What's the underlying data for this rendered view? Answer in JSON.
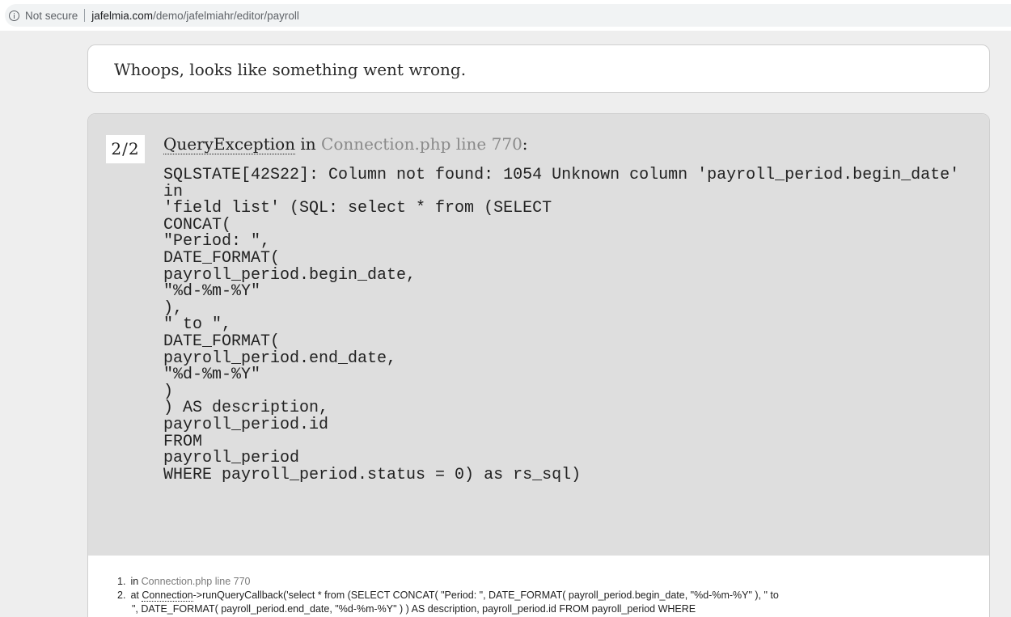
{
  "browser": {
    "security_icon": "info-icon",
    "security_label": "Not secure",
    "url_domain": "jafelmia.com",
    "url_path": "/demo/jafelmiahr/editor/payroll"
  },
  "page": {
    "whoops_message": "Whoops, looks like something went wrong."
  },
  "exception": {
    "count": "2/2",
    "class_name": "QueryException",
    "in_word": " in ",
    "location": "Connection.php line 770",
    "colon": ":",
    "message": "SQLSTATE[42S22]: Column not found: 1054 Unknown column 'payroll_period.begin_date' in\n'field list' (SQL: select * from (SELECT\nCONCAT(\n\"Period: \",\nDATE_FORMAT(\npayroll_period.begin_date,\n\"%d-%m-%Y\"\n),\n\" to \",\nDATE_FORMAT(\npayroll_period.end_date,\n\"%d-%m-%Y\"\n)\n) AS description,\npayroll_period.id\nFROM\npayroll_period\nWHERE payroll_period.status = 0) as rs_sql)"
  },
  "trace": {
    "item1": {
      "num": "1.",
      "prefix": "in",
      "location": "Connection.php line 770"
    },
    "item2": {
      "num": "2.",
      "prefix": "at",
      "class_name": "Connection",
      "call": "->runQueryCallback('select * from (SELECT CONCAT( \"Period: \", DATE_FORMAT( payroll_period.begin_date, \"%d-%m-%Y\" ), \" to",
      "continuation": "\", DATE_FORMAT( payroll_period.end_date, \"%d-%m-%Y\" ) ) AS description, payroll_period.id FROM payroll_period WHERE"
    }
  }
}
